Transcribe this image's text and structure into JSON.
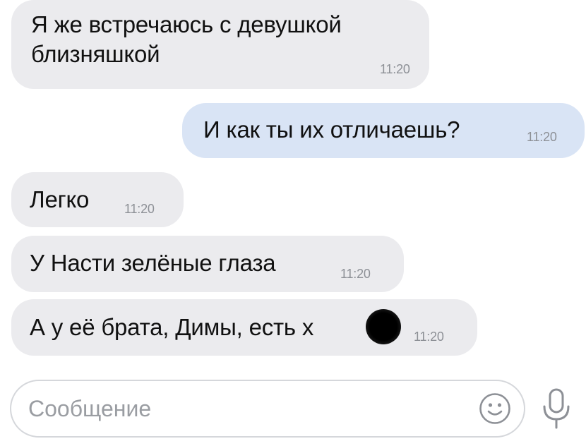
{
  "messages": [
    {
      "direction": "incoming",
      "text": "Я же встречаюсь с девушкой близняшкой",
      "time": "11:20"
    },
    {
      "direction": "outgoing",
      "text": "И как ты их отличаешь?",
      "time": "11:20"
    },
    {
      "direction": "incoming",
      "text": "Легко",
      "time": "11:20"
    },
    {
      "direction": "incoming",
      "text": "У Насти зелёные глаза",
      "time": "11:20"
    },
    {
      "direction": "incoming",
      "text": "А у её брата, Димы, есть х",
      "time": "11:20",
      "redacted": true
    }
  ],
  "composer": {
    "placeholder": "Сообщение",
    "value": "",
    "icons": [
      "emoji-icon",
      "microphone-icon"
    ]
  },
  "colors": {
    "incoming_bubble": "#ebebee",
    "outgoing_bubble": "#d9e4f5",
    "timestamp": "#8d9096",
    "input_border": "#d5d7db",
    "placeholder": "#9a9da2",
    "icon": "#8d9096"
  }
}
